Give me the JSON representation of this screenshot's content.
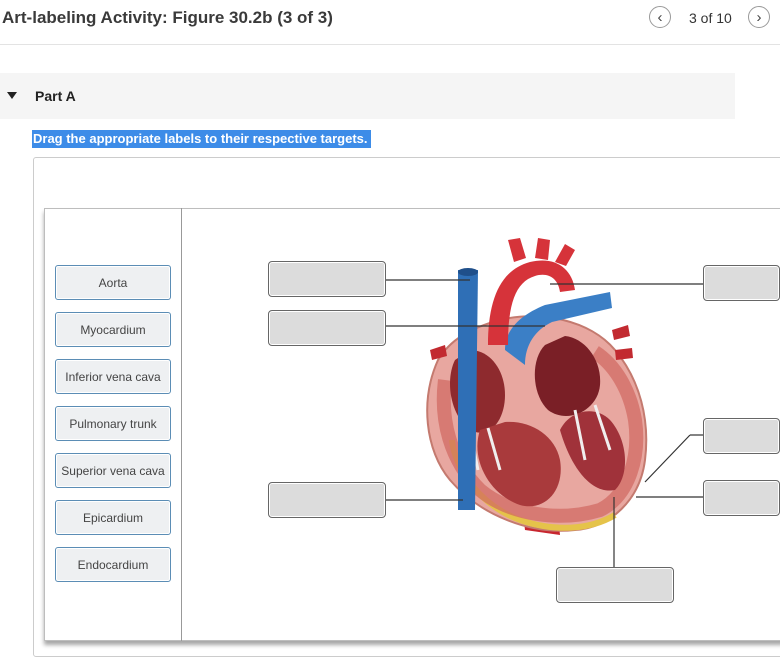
{
  "header": {
    "title": "Art-labeling Activity: Figure 30.2b (3 of 3)",
    "pager": "3 of 10",
    "prev_symbol": "‹",
    "next_symbol": "›"
  },
  "part": {
    "title": "Part A"
  },
  "instruction": "Drag the appropriate labels to their respective targets.",
  "labels": [
    "Aorta",
    "Myocardium",
    "Inferior vena cava",
    "Pulmonary trunk",
    "Superior vena cava",
    "Epicardium",
    "Endocardium"
  ],
  "colors": {
    "instruction_bg": "#3d8ce8",
    "label_border": "#5b8db5",
    "target_bg": "#dcdcdc"
  },
  "targets": [
    {
      "name": "target-top-left-1",
      "value": ""
    },
    {
      "name": "target-top-left-2",
      "value": ""
    },
    {
      "name": "target-bottom-left",
      "value": ""
    },
    {
      "name": "target-right-top",
      "value": ""
    },
    {
      "name": "target-right-middle",
      "value": ""
    },
    {
      "name": "target-right-bottom",
      "value": ""
    },
    {
      "name": "target-bottom",
      "value": ""
    }
  ]
}
